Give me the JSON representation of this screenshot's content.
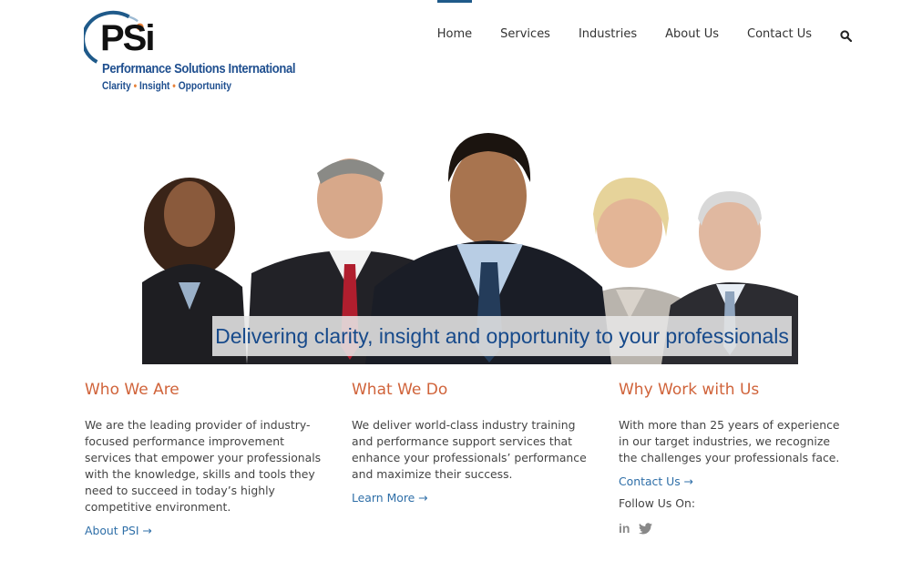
{
  "logo": {
    "letters": "PSi",
    "name": "Performance Solutions International",
    "tagline": [
      "Clarity",
      "Insight",
      "Opportunity"
    ],
    "tagline_separator": "•",
    "colors": {
      "ring": "#1f5a8a",
      "dot": "#e8823a",
      "text": "#1f4f8f"
    }
  },
  "nav": {
    "items": [
      {
        "label": "Home",
        "active": true
      },
      {
        "label": "Services"
      },
      {
        "label": "Industries"
      },
      {
        "label": "About Us"
      },
      {
        "label": "Contact Us"
      }
    ],
    "search_icon": "search-icon"
  },
  "hero": {
    "caption": "Delivering clarity, insight and opportunity to your professionals"
  },
  "columns": [
    {
      "heading": "Who We Are",
      "body": "We are the leading provider of industry-focused performance improvement services that empower your professionals with the knowledge, skills and tools they need to succeed in today’s highly competitive environment.",
      "link": "About PSI →"
    },
    {
      "heading": "What We Do",
      "body": "We deliver world-class industry training and performance support services that enhance your professionals’ performance and maximize their success.",
      "link": "Learn More →"
    },
    {
      "heading": "Why Work with Us",
      "body": "With more than 25 years of experience in our target industries, we recognize the challenges your professionals face.",
      "link": "Contact Us →",
      "follow_label": "Follow Us On:",
      "social": [
        {
          "icon": "linkedin-icon",
          "glyph": "in"
        },
        {
          "icon": "twitter-icon",
          "glyph": ""
        }
      ]
    }
  ],
  "colors": {
    "accent": "#d0633a",
    "link": "#2f6fa8",
    "nav_active": "#1f5a8a",
    "caption_text": "#174a8b"
  }
}
